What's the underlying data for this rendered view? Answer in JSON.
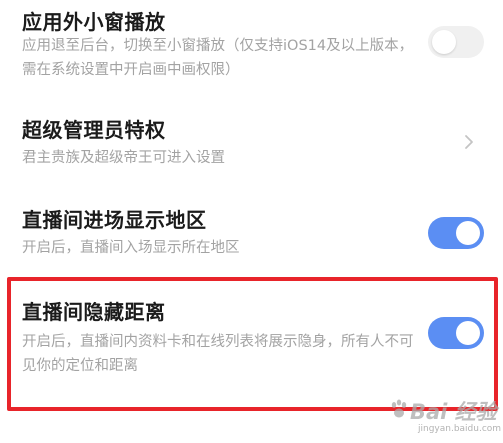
{
  "settings": [
    {
      "title": "应用外小窗播放",
      "description": "应用退至后台，切换至小窗播放（仅支持iOS14及以上版本，需在系统设置中开启画中画权限）",
      "control": "toggle",
      "enabled": false
    },
    {
      "title": "超级管理员特权",
      "description": "君主贵族及超级帝王可进入设置",
      "control": "chevron",
      "icon": "chevron-right-icon"
    },
    {
      "title": "直播间进场显示地区",
      "description": "开启后，直播间入场显示所在地区",
      "control": "toggle",
      "enabled": true
    },
    {
      "title": "直播间隐藏距离",
      "description": "开启后，直播间内资料卡和在线列表将展示隐身，所有人不可见你的定位和距离",
      "control": "toggle",
      "enabled": true
    }
  ],
  "watermark": {
    "text": "Bai 经验",
    "url": "jingyan.baidu.com"
  },
  "colors": {
    "toggle_on": "#5b8ef3",
    "toggle_off": "#f0f0f0",
    "title": "#1b1b1b",
    "description": "#a3a3a3",
    "highlight_border": "#e8242a"
  }
}
